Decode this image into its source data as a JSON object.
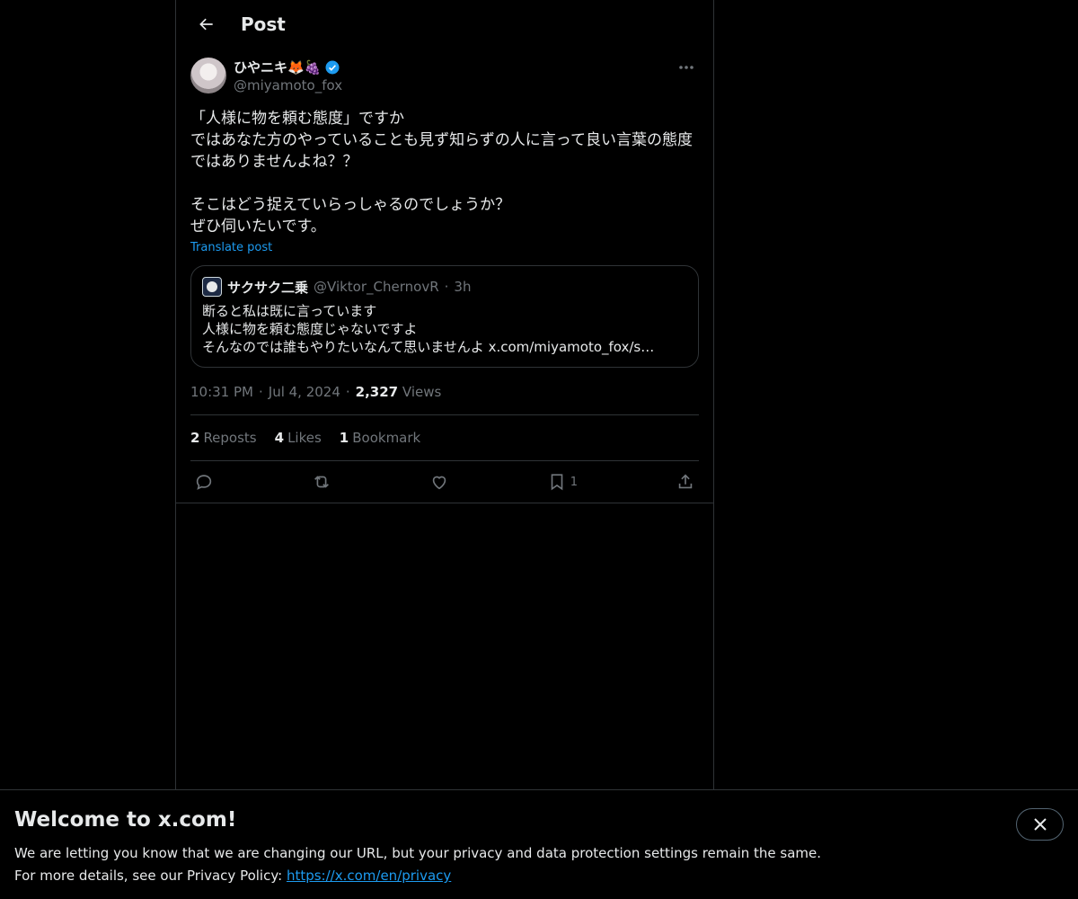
{
  "header": {
    "title": "Post"
  },
  "post": {
    "display_name": "ひやニキ🦊🍇",
    "handle": "@miyamoto_fox",
    "text": "「人様に物を頼む態度」ですか\nではあなた方のやっていることも見ず知らずの人に言って良い言葉の態度ではありませんよね？？\n\nそこはどう捉えていらっしゃるのでしょうか？\nぜひ伺いたいです。",
    "translate_label": "Translate post",
    "time": "10:31 PM",
    "date": "Jul 4, 2024",
    "views_count": "2,327",
    "views_label": "Views"
  },
  "quote": {
    "name": "サクサク二乗",
    "handle": "@Viktor_ChernovR",
    "dot": "·",
    "time": "3h",
    "text": "断ると私は既に言っています\n人様に物を頼む態度じゃないですよ\nそんなのでは誰もやりたいなんて思いませんよ x.com/miyamoto_fox/s…"
  },
  "stats": {
    "reposts_count": "2",
    "reposts_label": "Reposts",
    "likes_count": "4",
    "likes_label": "Likes",
    "bookmarks_count": "1",
    "bookmarks_label": "Bookmark"
  },
  "actions": {
    "bookmark_count": "1"
  },
  "banner": {
    "title": "Welcome to x.com!",
    "line1": "We are letting you know that we are changing our URL, but your privacy and data protection settings remain the same.",
    "line2_prefix": "For more details, see our Privacy Policy: ",
    "link": "https://x.com/en/privacy"
  },
  "colors": {
    "accent": "#1d9bf0",
    "background": "#000000",
    "border": "#2f3336",
    "muted": "#71767b"
  }
}
